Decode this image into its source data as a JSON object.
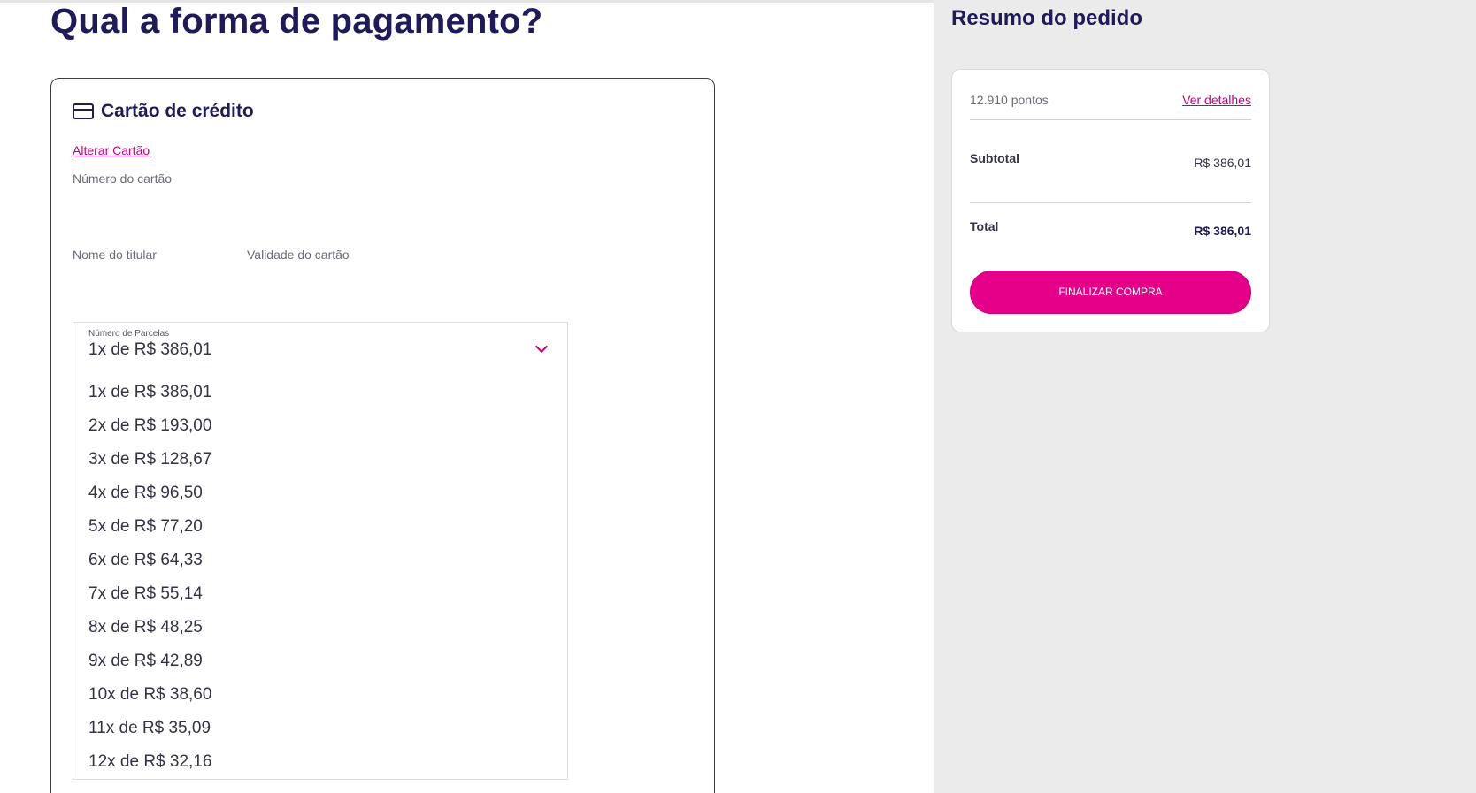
{
  "page": {
    "title": "Qual a forma de pagamento?"
  },
  "payment": {
    "method_title": "Cartão de crédito",
    "method_icon": "credit-card-icon",
    "change_card_link": "Alterar Cartão",
    "card_number_label": "Número do cartão",
    "holder_name_label": "Nome do titular",
    "expiry_label": "Validade do cartão",
    "installments": {
      "caption": "Número de Parcelas",
      "selected": "1x de R$ 386,01",
      "options": [
        "1x de R$ 386,01",
        "2x de R$ 193,00",
        "3x de R$ 128,67",
        "4x de R$ 96,50",
        "5x de R$ 77,20",
        "6x de R$ 64,33",
        "7x de R$ 55,14",
        "8x de R$ 48,25",
        "9x de R$ 42,89",
        "10x de R$ 38,60",
        "11x de R$ 35,09",
        "12x de R$ 32,16"
      ]
    }
  },
  "summary": {
    "title": "Resumo do pedido",
    "points": "12.910 pontos",
    "details_link": "Ver detalhes",
    "subtotal_label": "Subtotal",
    "subtotal_value": "R$ 386,01",
    "total_label": "Total",
    "total_value": "R$ 386,01",
    "finish_button": "FINALIZAR COMPRA"
  },
  "colors": {
    "primary_text": "#1f1a5a",
    "accent": "#e5008a",
    "link": "#c5007f",
    "panel_bg": "#ebebeb"
  }
}
